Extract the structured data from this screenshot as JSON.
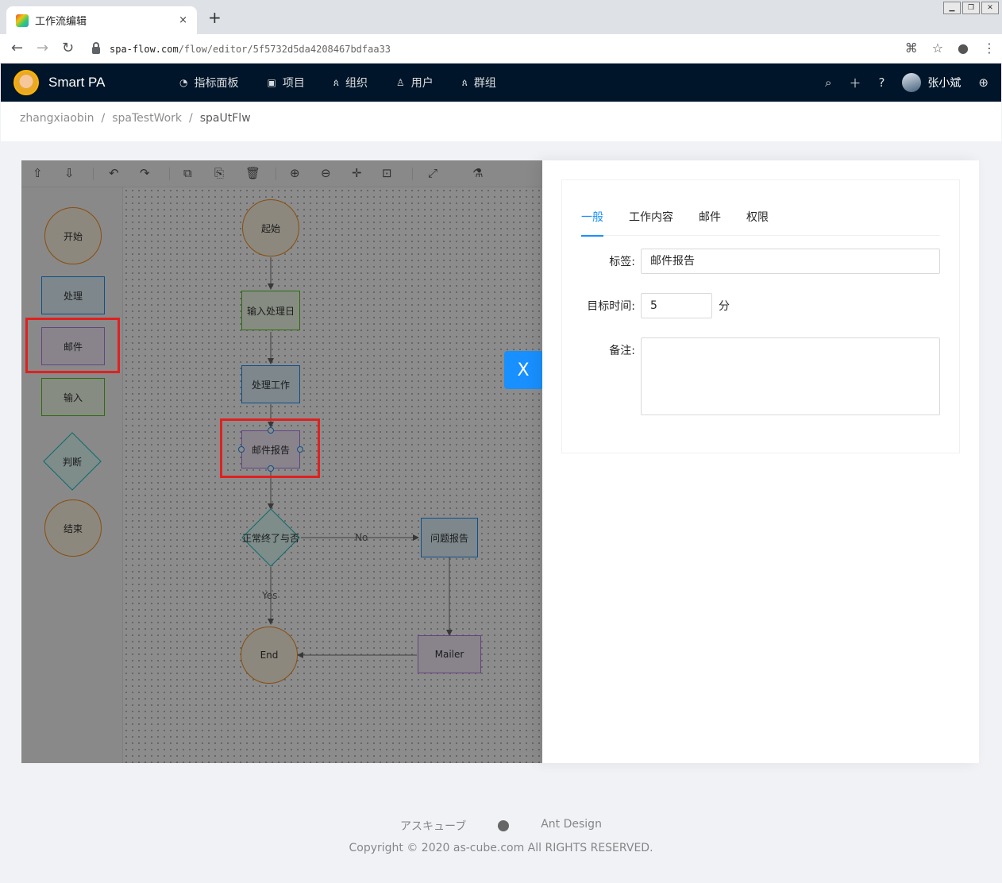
{
  "browser": {
    "tab_title": "工作流编辑",
    "close_glyph": "×",
    "new_tab_glyph": "+",
    "url_host": "spa-flow.com",
    "url_path": "/flow/editor/5f5732d5da4208467bdfaa33"
  },
  "header": {
    "brand": "Smart PA",
    "menu": [
      {
        "label": "指标面板",
        "icon": "dashboard-icon"
      },
      {
        "label": "项目",
        "icon": "project-icon"
      },
      {
        "label": "组织",
        "icon": "team-icon"
      },
      {
        "label": "用户",
        "icon": "user-icon"
      },
      {
        "label": "群组",
        "icon": "group-icon"
      }
    ],
    "username": "张小斌"
  },
  "breadcrumb": [
    "zhangxiaobin",
    "spaTestWork",
    "spaUtFlw"
  ],
  "palette": {
    "start": "开始",
    "process": "处理",
    "mail": "邮件",
    "input": "输入",
    "decision": "判断",
    "end": "结束"
  },
  "flow": {
    "start": "起始",
    "input": "输入处理日",
    "process": "处理工作",
    "mail": "邮件报告",
    "decision": "正常终了与否",
    "issue": "问题报告",
    "end": "End",
    "mailer": "Mailer",
    "edge_no": "No",
    "edge_yes": "Yes"
  },
  "drawer": {
    "close_glyph": "X",
    "tabs": [
      "一般",
      "工作内容",
      "邮件",
      "权限"
    ],
    "active_tab": "一般",
    "label_label": "标签:",
    "label_value": "邮件报告",
    "target_time_label": "目标时间:",
    "target_time_value": "5",
    "target_time_unit": "分",
    "note_label": "备注:",
    "note_value": ""
  },
  "footer": {
    "links": [
      "アスキューブ",
      "Ant Design"
    ],
    "copyright": "Copyright © 2020 as-cube.com All RIGHTS RESERVED."
  },
  "colors": {
    "header_bg": "#001529",
    "accent": "#1890ff",
    "highlight": "#e02020"
  }
}
